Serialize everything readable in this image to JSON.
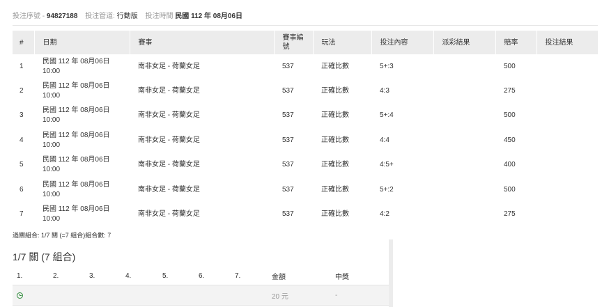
{
  "ticket": {
    "serial_label": "投注序號",
    "serial_sep": "-",
    "serial_value": "94827188",
    "channel_label": "投注管道:",
    "channel_value": "行動版",
    "time_label": "投注時間",
    "time_value": "民國 112 年 08月06日"
  },
  "table": {
    "headers": [
      "#",
      "日期",
      "賽事",
      "賽事編號",
      "玩法",
      "投注內容",
      "派彩結果",
      "賠率",
      "投注結果"
    ],
    "rows": [
      {
        "no": "1",
        "date": "民國 112 年 08月06日",
        "time": "10:00",
        "match": "南非女足 - 荷蘭女足",
        "code": "537",
        "type": "正確比數",
        "content": "5+:3",
        "payout": "",
        "odds": "500",
        "result": ""
      },
      {
        "no": "2",
        "date": "民國 112 年 08月06日",
        "time": "10:00",
        "match": "南非女足 - 荷蘭女足",
        "code": "537",
        "type": "正確比數",
        "content": "4:3",
        "payout": "",
        "odds": "275",
        "result": ""
      },
      {
        "no": "3",
        "date": "民國 112 年 08月06日",
        "time": "10:00",
        "match": "南非女足 - 荷蘭女足",
        "code": "537",
        "type": "正確比數",
        "content": "5+:4",
        "payout": "",
        "odds": "500",
        "result": ""
      },
      {
        "no": "4",
        "date": "民國 112 年 08月06日",
        "time": "10:00",
        "match": "南非女足 - 荷蘭女足",
        "code": "537",
        "type": "正確比數",
        "content": "4:4",
        "payout": "",
        "odds": "450",
        "result": ""
      },
      {
        "no": "5",
        "date": "民國 112 年 08月06日",
        "time": "10:00",
        "match": "南非女足 - 荷蘭女足",
        "code": "537",
        "type": "正確比數",
        "content": "4:5+",
        "payout": "",
        "odds": "400",
        "result": ""
      },
      {
        "no": "6",
        "date": "民國 112 年 08月06日",
        "time": "10:00",
        "match": "南非女足 - 荷蘭女足",
        "code": "537",
        "type": "正確比數",
        "content": "5+:2",
        "payout": "",
        "odds": "500",
        "result": ""
      },
      {
        "no": "7",
        "date": "民國 112 年 08月06日",
        "time": "10:00",
        "match": "南非女足 - 荷蘭女足",
        "code": "537",
        "type": "正確比數",
        "content": "4:2",
        "payout": "",
        "odds": "275",
        "result": ""
      }
    ]
  },
  "combo": {
    "summary": "過關組合: 1/7 關 (=7 組合)組合數: 7",
    "title": "1/7 關 (7 組合)",
    "columns": [
      "1.",
      "2.",
      "3.",
      "4.",
      "5.",
      "6.",
      "7.",
      "金額",
      "中獎"
    ],
    "row": {
      "status_icon": "clock-icon",
      "amount": "20 元",
      "win": "-"
    },
    "icon_color": "#2e8b3a"
  }
}
